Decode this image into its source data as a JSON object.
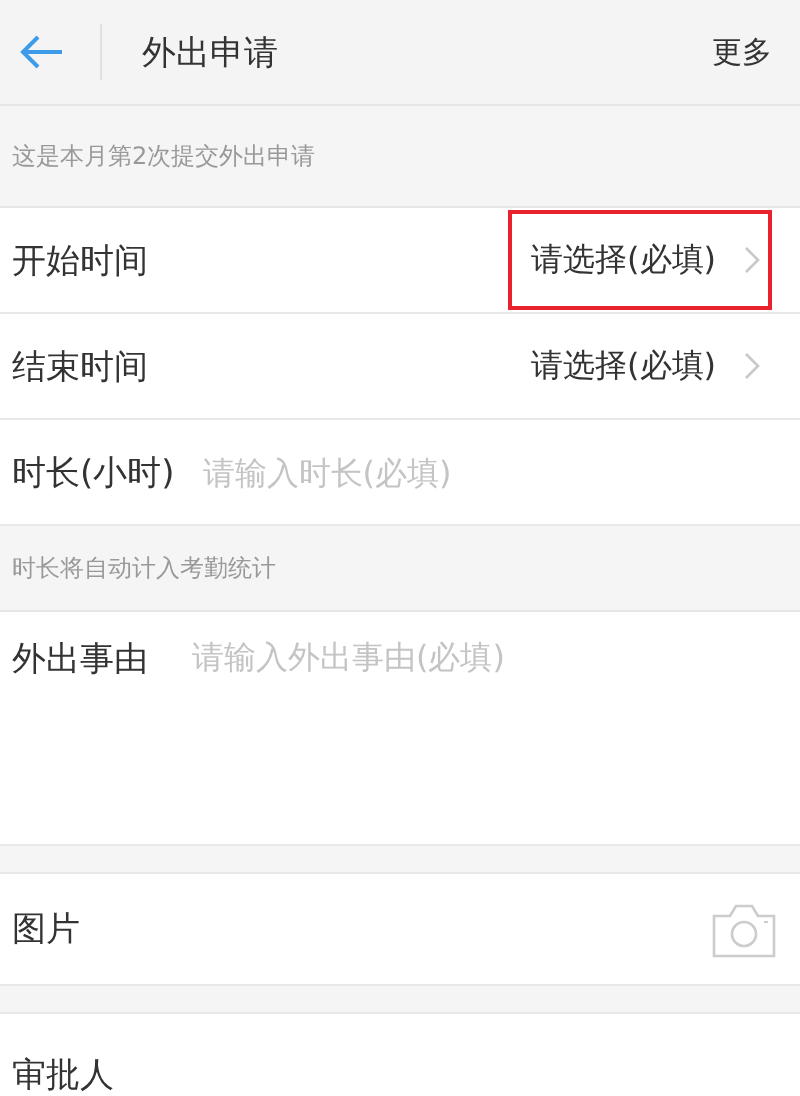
{
  "header": {
    "title": "外出申请",
    "more": "更多"
  },
  "notice": "这是本月第2次提交外出申请",
  "fields": [
    {
      "kind": "select",
      "label": "开始时间",
      "value": "请选择(必填)",
      "highlighted": true
    },
    {
      "kind": "select",
      "label": "结束时间",
      "value": "请选择(必填)",
      "highlighted": false
    },
    {
      "kind": "input",
      "label": "时长(小时)",
      "placeholder": "请输入时长(必填)"
    }
  ],
  "hint": "时长将自动计入考勤统计",
  "reason": {
    "label": "外出事由",
    "placeholder": "请输入外出事由(必填)"
  },
  "photo": {
    "label": "图片"
  },
  "approver": {
    "label": "审批人"
  }
}
